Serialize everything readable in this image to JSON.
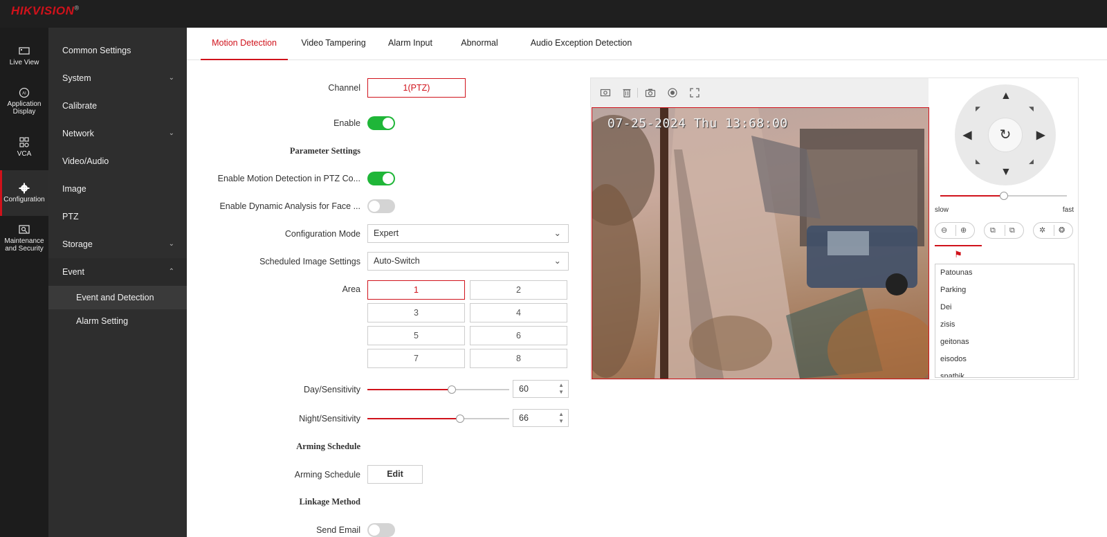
{
  "brand": {
    "logo": "HIKVISION",
    "reg": "®"
  },
  "rail": [
    {
      "label": "Live View",
      "icon": "live-view-icon"
    },
    {
      "label": "Application Display",
      "icon": "ai-icon"
    },
    {
      "label": "VCA",
      "icon": "vca-icon"
    },
    {
      "label": "Configuration",
      "icon": "gear-icon",
      "active": true
    },
    {
      "label": "Maintenance and Security",
      "icon": "maintenance-icon"
    }
  ],
  "menu": {
    "items": [
      {
        "label": "Common Settings",
        "chevron": ""
      },
      {
        "label": "System",
        "chevron": "⌄"
      },
      {
        "label": "Calibrate",
        "chevron": ""
      },
      {
        "label": "Network",
        "chevron": "⌄"
      },
      {
        "label": "Video/Audio",
        "chevron": ""
      },
      {
        "label": "Image",
        "chevron": ""
      },
      {
        "label": "PTZ",
        "chevron": ""
      },
      {
        "label": "Storage",
        "chevron": "⌄"
      },
      {
        "label": "Event",
        "chevron": "⌃"
      }
    ],
    "sub": [
      {
        "label": "Event and Detection",
        "active": true
      },
      {
        "label": "Alarm Setting"
      }
    ]
  },
  "tabs": [
    {
      "label": "Motion Detection",
      "active": true
    },
    {
      "label": "Video Tampering"
    },
    {
      "label": "Alarm Input"
    },
    {
      "label": "Abnormal"
    },
    {
      "label": "Audio Exception Detection"
    }
  ],
  "form": {
    "channel_label": "Channel",
    "channel_value": "1(PTZ)",
    "enable_label": "Enable",
    "enable_on": true,
    "param_section": "Parameter Settings",
    "ptz_motion_label": "Enable Motion Detection in PTZ Co...",
    "ptz_motion_on": true,
    "dynamic_label": "Enable Dynamic Analysis for Face ...",
    "dynamic_on": false,
    "config_mode_label": "Configuration Mode",
    "config_mode_value": "Expert",
    "sched_img_label": "Scheduled Image Settings",
    "sched_img_value": "Auto-Switch",
    "area_label": "Area",
    "areas": [
      "1",
      "2",
      "3",
      "4",
      "5",
      "6",
      "7",
      "8"
    ],
    "area_selected": "1",
    "day_label": "Day/Sensitivity",
    "day_value": "60",
    "night_label": "Night/Sensitivity",
    "night_value": "66",
    "arming_section": "Arming Schedule",
    "arming_label": "Arming Schedule",
    "arming_button": "Edit",
    "linkage_section": "Linkage Method",
    "send_email_label": "Send Email",
    "send_email_on": false
  },
  "video": {
    "osd": "07-25-2024 Thu 13:68:00",
    "toolbar_icons": [
      "capture-region-icon",
      "trash-icon",
      "camera-icon",
      "record-icon",
      "fullscreen-icon"
    ]
  },
  "ptz": {
    "speed_slow": "slow",
    "speed_fast": "fast",
    "speed_level": 0.5,
    "preset_tab_icon": "flag-icon",
    "presets": [
      "Patounas",
      "Parking",
      "Dei",
      "zisis",
      "geitonas",
      "eisodos",
      "spathik"
    ]
  },
  "colors": {
    "accent": "#d0121b",
    "toggle_on": "#1fb638",
    "topbar": "#1f1f1f",
    "menu": "#2e2e2e"
  }
}
